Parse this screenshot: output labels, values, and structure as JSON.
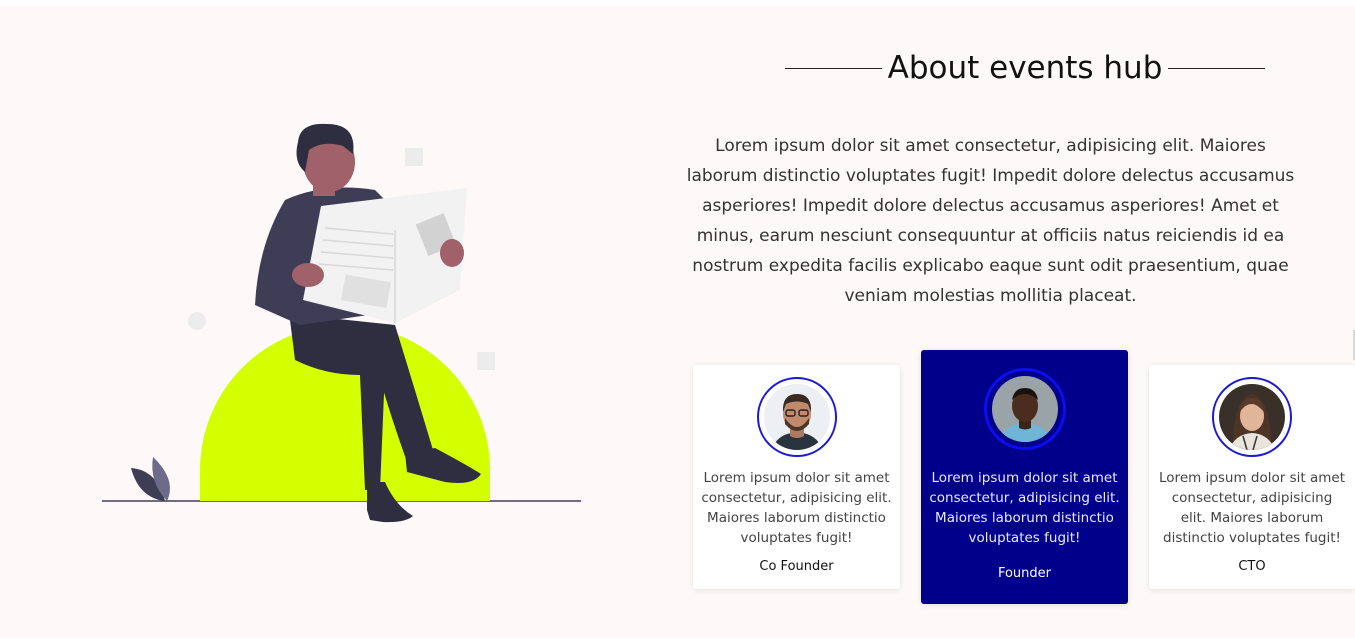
{
  "about": {
    "title": "About events hub",
    "text": "Lorem ipsum dolor sit amet consectetur, adipisicing elit. Maiores laborum distinctio voluptates fugit! Impedit dolore delectus accusamus asperiores! Impedit dolore delectus accusamus asperiores! Amet et minus, earum nesciunt consequuntur at officiis natus reiciendis id ea nostrum expedita facilis explicabo eaque sunt odit praesentium, quae veniam molestias mollitia placeat."
  },
  "team": [
    {
      "role": "Co Founder",
      "text": "Lorem ipsum dolor sit amet consectetur, adipisicing elit. Maiores laborum distinctio voluptates fugit!",
      "active": false
    },
    {
      "role": "Founder",
      "text": "Lorem ipsum dolor sit amet consectetur, adipisicing elit. Maiores laborum distinctio voluptates fugit!",
      "active": true
    },
    {
      "role": "CTO",
      "text": "Lorem ipsum dolor sit amet consectetur, adipisicing elit. Maiores laborum distinctio voluptates fugit!",
      "active": false
    }
  ],
  "colors": {
    "accent": "#00008b",
    "highlight": "#d4ff00",
    "ring": "#1a1ad6",
    "figure": "#3f3d56"
  },
  "icons": {
    "illustration": "man-reading-newspaper-illustration"
  }
}
